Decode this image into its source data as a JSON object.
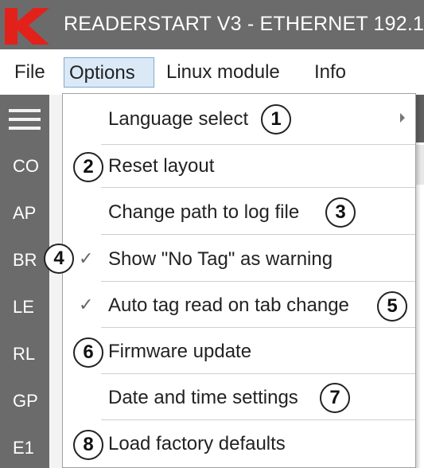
{
  "window": {
    "title": "READERSTART V3 - ETHERNET 192.1",
    "logo_letter": "K",
    "accent_color": "#e3211b"
  },
  "menubar": {
    "items": [
      {
        "label": "File"
      },
      {
        "label": "Options"
      },
      {
        "label": "Linux module"
      },
      {
        "label": "Info"
      }
    ]
  },
  "sidebar": {
    "items": [
      {
        "label": "CO"
      },
      {
        "label": "AP"
      },
      {
        "label": "BR"
      },
      {
        "label": "LE"
      },
      {
        "label": "RL"
      },
      {
        "label": "GP"
      },
      {
        "label": "E1"
      }
    ]
  },
  "options_menu": {
    "items": [
      {
        "label": "Language select",
        "callout": "1",
        "checked": false,
        "submenu": true
      },
      {
        "label": "Reset layout",
        "callout": "2",
        "checked": false
      },
      {
        "label": "Change path to log file",
        "callout": "3",
        "checked": false
      },
      {
        "label": "Show \"No Tag\" as warning",
        "callout": "4",
        "checked": true
      },
      {
        "label": "Auto tag read on tab change",
        "callout": "5",
        "checked": true
      },
      {
        "label": "Firmware update",
        "callout": "6",
        "checked": false
      },
      {
        "label": "Date and time settings",
        "callout": "7",
        "checked": false
      },
      {
        "label": "Load factory defaults",
        "callout": "8",
        "checked": false
      }
    ],
    "check_glyph": "✓"
  }
}
